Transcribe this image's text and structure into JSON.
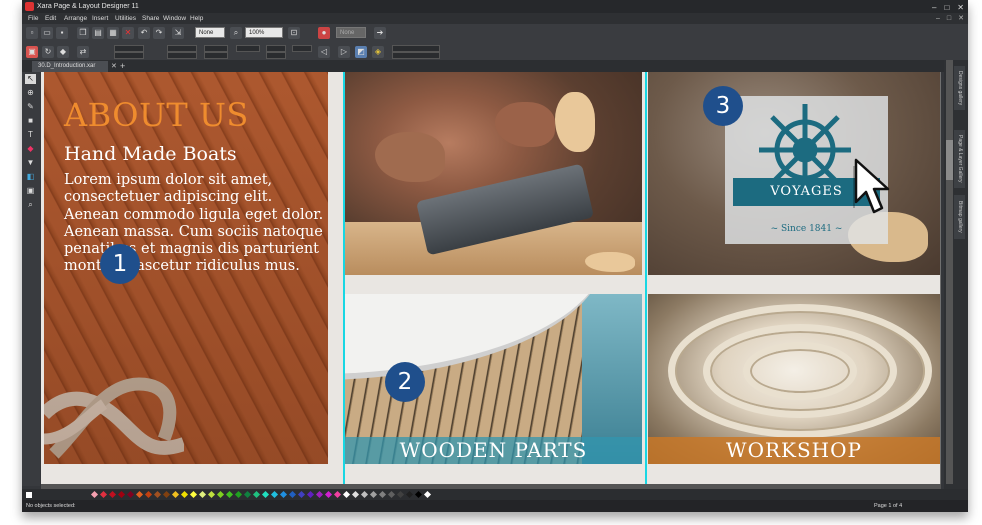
{
  "window": {
    "title": "Xara Page & Layout Designer 11",
    "controls": [
      "–",
      "□",
      "✕"
    ]
  },
  "menu": {
    "items": [
      "File",
      "Edit",
      "Arrange",
      "Insert",
      "Utilities",
      "Share",
      "Window",
      "Help"
    ],
    "right_controls": [
      "–",
      "□",
      "✕"
    ]
  },
  "toolbar": {
    "quality_value": "None",
    "zoom_value": "100%",
    "disabled_dropdown": "None"
  },
  "document_tab": {
    "label": "30.D_Introduction.xar",
    "close": "✕",
    "add": "+"
  },
  "page": {
    "about_title": "ABOUT US",
    "about_subtitle": "Hand Made Boats",
    "about_body": "Lorem ipsum dolor sit amet, consectetuer adipiscing elit. Aenean commodo ligula eget dolor. Aenean massa. Cum sociis natoque penatibus et magnis dis parturient montes, nascetur ridiculus mus.",
    "caption_wooden_parts": "WOODEN PARTS",
    "caption_workshop": "WORKSHOP",
    "logo_banner": "VOYAGES",
    "logo_since": "~ Since 1841 ~"
  },
  "callouts": [
    "1",
    "2",
    "3"
  ],
  "side_panels": [
    "Designs gallery",
    "Page & Layer Gallery",
    "Bitmap gallery"
  ],
  "colors": {
    "accent_orange": "#ef8c2e",
    "guide_cyan": "#18d7e3",
    "badge_blue": "#1f4f8c",
    "caption_teal": "#3296af",
    "caption_orange": "#c87828",
    "logo_teal": "#1c6b80",
    "palette": [
      "#f5a0b0",
      "#e03040",
      "#c01020",
      "#a00010",
      "#800020",
      "#e06020",
      "#c04010",
      "#a05020",
      "#804010",
      "#f0c020",
      "#f0e000",
      "#ffff40",
      "#e0f080",
      "#c0e040",
      "#80d020",
      "#40c020",
      "#20a020",
      "#108040",
      "#20c080",
      "#20e0c0",
      "#20c0e0",
      "#2090e0",
      "#2060c0",
      "#4040c0",
      "#6020c0",
      "#a020c0",
      "#d020d0",
      "#f040a0",
      "#ffffff",
      "#e0e0e0",
      "#c0c0c0",
      "#a0a0a0",
      "#808080",
      "#606060",
      "#404040",
      "#202020",
      "#000000",
      "#ffffff"
    ]
  },
  "status": {
    "message": "No objects selected:",
    "page_indicator": "Page 1 of 4"
  }
}
